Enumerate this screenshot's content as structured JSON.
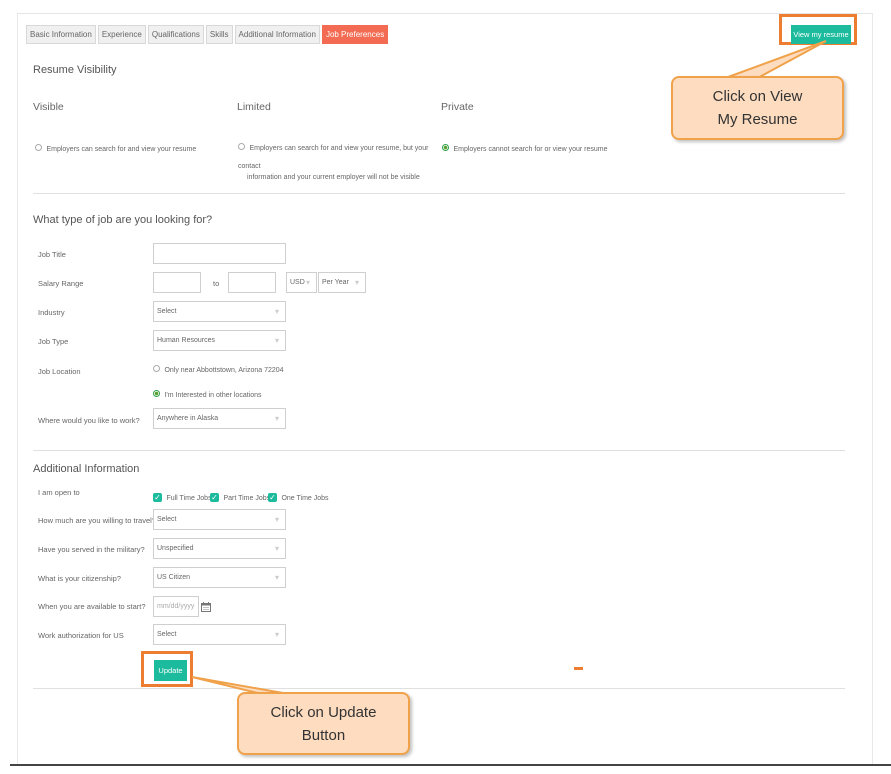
{
  "tabs": [
    "Basic Information",
    "Experience",
    "Qualifications",
    "Skills",
    "Additional Information",
    "Job Preferences"
  ],
  "active_tab": "Job Preferences",
  "view_resume_button": "View my resume",
  "resume_visibility": {
    "title": "Resume Visibility",
    "options": [
      {
        "title": "Visible",
        "text": "Employers can search for and view your resume",
        "selected": false
      },
      {
        "title": "Limited",
        "text": "Employers can search for and view your resume, but your contact",
        "text2": "information and your current employer will not be visible",
        "selected": false
      },
      {
        "title": "Private",
        "text": "Employers cannot search for or view your resume",
        "selected": true
      }
    ]
  },
  "job_search": {
    "title": "What type of job are you looking for?",
    "job_title_label": "Job Title",
    "salary_label": "Salary Range",
    "salary_to": "to",
    "currency": "USD",
    "period": "Per Year",
    "industry_label": "Industry",
    "industry_value": "Select",
    "job_type_label": "Job Type",
    "job_type_value": "Human Resources",
    "location_label": "Job Location",
    "location_option1": "Only near Abbottstown, Arizona 72204",
    "location_option2": "I'm Interested in other locations",
    "where_label": "Where would you like to work?",
    "where_value": "Anywhere in Alaska"
  },
  "additional": {
    "title": "Additional Information",
    "open_to_label": "I am open to",
    "open_to": [
      "Full Time Jobs",
      "Part Time Jobs",
      "One Time Jobs"
    ],
    "travel_label": "How much are you willing to travel?",
    "travel_value": "Select",
    "military_label": "Have you served in the military?",
    "military_value": "Unspecified",
    "citizenship_label": "What is your citizenship?",
    "citizenship_value": "US Citizen",
    "start_label": "When you are available to start?",
    "start_placeholder": "mm/dd/yyyy",
    "auth_label": "Work authorization for US",
    "auth_value": "Select"
  },
  "update_button": "Update",
  "callouts": {
    "view_resume_line1": "Click on View",
    "view_resume_line2": "My Resume",
    "update_line1": "Click on Update",
    "update_line2": "Button"
  },
  "colors": {
    "accent": "#1dbb9d",
    "active_tab": "#f26b52",
    "highlight": "#ed7d31",
    "callout_fill": "#fddcc0"
  },
  "icons": [
    "calendar-icon",
    "checkbox-checked-icon",
    "radio-selected-icon",
    "dropdown-arrow-icon"
  ]
}
